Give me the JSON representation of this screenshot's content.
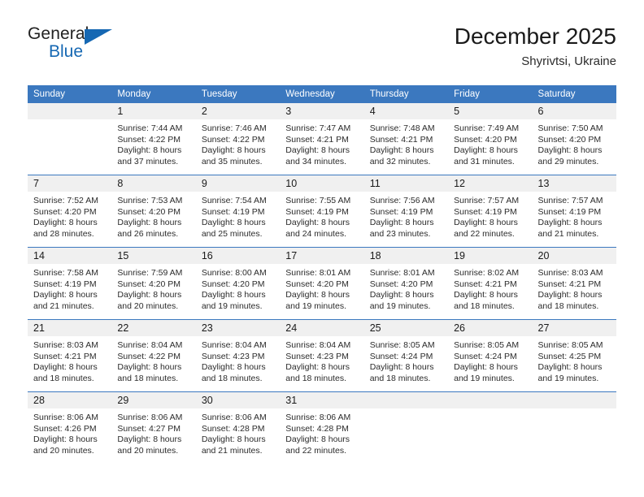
{
  "brand": {
    "word_top": "General",
    "word_bottom": "Blue",
    "accent_color": "#1668b3",
    "triangle_icon": "triangle-right-icon"
  },
  "header": {
    "title": "December 2025",
    "subtitle": "Shyrivtsi, Ukraine"
  },
  "calendar": {
    "header_color": "#3b78bf",
    "daynum_band_color": "#f0f0f0",
    "columns": [
      "Sunday",
      "Monday",
      "Tuesday",
      "Wednesday",
      "Thursday",
      "Friday",
      "Saturday"
    ],
    "labels": {
      "sunrise": "Sunrise:",
      "sunset": "Sunset:",
      "daylight": "Daylight:"
    },
    "weeks": [
      [
        {
          "day": "",
          "sunrise": "",
          "sunset": "",
          "daylight_line1": "",
          "daylight_line2": ""
        },
        {
          "day": "1",
          "sunrise": "Sunrise: 7:44 AM",
          "sunset": "Sunset: 4:22 PM",
          "daylight_line1": "Daylight: 8 hours",
          "daylight_line2": "and 37 minutes."
        },
        {
          "day": "2",
          "sunrise": "Sunrise: 7:46 AM",
          "sunset": "Sunset: 4:22 PM",
          "daylight_line1": "Daylight: 8 hours",
          "daylight_line2": "and 35 minutes."
        },
        {
          "day": "3",
          "sunrise": "Sunrise: 7:47 AM",
          "sunset": "Sunset: 4:21 PM",
          "daylight_line1": "Daylight: 8 hours",
          "daylight_line2": "and 34 minutes."
        },
        {
          "day": "4",
          "sunrise": "Sunrise: 7:48 AM",
          "sunset": "Sunset: 4:21 PM",
          "daylight_line1": "Daylight: 8 hours",
          "daylight_line2": "and 32 minutes."
        },
        {
          "day": "5",
          "sunrise": "Sunrise: 7:49 AM",
          "sunset": "Sunset: 4:20 PM",
          "daylight_line1": "Daylight: 8 hours",
          "daylight_line2": "and 31 minutes."
        },
        {
          "day": "6",
          "sunrise": "Sunrise: 7:50 AM",
          "sunset": "Sunset: 4:20 PM",
          "daylight_line1": "Daylight: 8 hours",
          "daylight_line2": "and 29 minutes."
        }
      ],
      [
        {
          "day": "7",
          "sunrise": "Sunrise: 7:52 AM",
          "sunset": "Sunset: 4:20 PM",
          "daylight_line1": "Daylight: 8 hours",
          "daylight_line2": "and 28 minutes."
        },
        {
          "day": "8",
          "sunrise": "Sunrise: 7:53 AM",
          "sunset": "Sunset: 4:20 PM",
          "daylight_line1": "Daylight: 8 hours",
          "daylight_line2": "and 26 minutes."
        },
        {
          "day": "9",
          "sunrise": "Sunrise: 7:54 AM",
          "sunset": "Sunset: 4:19 PM",
          "daylight_line1": "Daylight: 8 hours",
          "daylight_line2": "and 25 minutes."
        },
        {
          "day": "10",
          "sunrise": "Sunrise: 7:55 AM",
          "sunset": "Sunset: 4:19 PM",
          "daylight_line1": "Daylight: 8 hours",
          "daylight_line2": "and 24 minutes."
        },
        {
          "day": "11",
          "sunrise": "Sunrise: 7:56 AM",
          "sunset": "Sunset: 4:19 PM",
          "daylight_line1": "Daylight: 8 hours",
          "daylight_line2": "and 23 minutes."
        },
        {
          "day": "12",
          "sunrise": "Sunrise: 7:57 AM",
          "sunset": "Sunset: 4:19 PM",
          "daylight_line1": "Daylight: 8 hours",
          "daylight_line2": "and 22 minutes."
        },
        {
          "day": "13",
          "sunrise": "Sunrise: 7:57 AM",
          "sunset": "Sunset: 4:19 PM",
          "daylight_line1": "Daylight: 8 hours",
          "daylight_line2": "and 21 minutes."
        }
      ],
      [
        {
          "day": "14",
          "sunrise": "Sunrise: 7:58 AM",
          "sunset": "Sunset: 4:19 PM",
          "daylight_line1": "Daylight: 8 hours",
          "daylight_line2": "and 21 minutes."
        },
        {
          "day": "15",
          "sunrise": "Sunrise: 7:59 AM",
          "sunset": "Sunset: 4:20 PM",
          "daylight_line1": "Daylight: 8 hours",
          "daylight_line2": "and 20 minutes."
        },
        {
          "day": "16",
          "sunrise": "Sunrise: 8:00 AM",
          "sunset": "Sunset: 4:20 PM",
          "daylight_line1": "Daylight: 8 hours",
          "daylight_line2": "and 19 minutes."
        },
        {
          "day": "17",
          "sunrise": "Sunrise: 8:01 AM",
          "sunset": "Sunset: 4:20 PM",
          "daylight_line1": "Daylight: 8 hours",
          "daylight_line2": "and 19 minutes."
        },
        {
          "day": "18",
          "sunrise": "Sunrise: 8:01 AM",
          "sunset": "Sunset: 4:20 PM",
          "daylight_line1": "Daylight: 8 hours",
          "daylight_line2": "and 19 minutes."
        },
        {
          "day": "19",
          "sunrise": "Sunrise: 8:02 AM",
          "sunset": "Sunset: 4:21 PM",
          "daylight_line1": "Daylight: 8 hours",
          "daylight_line2": "and 18 minutes."
        },
        {
          "day": "20",
          "sunrise": "Sunrise: 8:03 AM",
          "sunset": "Sunset: 4:21 PM",
          "daylight_line1": "Daylight: 8 hours",
          "daylight_line2": "and 18 minutes."
        }
      ],
      [
        {
          "day": "21",
          "sunrise": "Sunrise: 8:03 AM",
          "sunset": "Sunset: 4:21 PM",
          "daylight_line1": "Daylight: 8 hours",
          "daylight_line2": "and 18 minutes."
        },
        {
          "day": "22",
          "sunrise": "Sunrise: 8:04 AM",
          "sunset": "Sunset: 4:22 PM",
          "daylight_line1": "Daylight: 8 hours",
          "daylight_line2": "and 18 minutes."
        },
        {
          "day": "23",
          "sunrise": "Sunrise: 8:04 AM",
          "sunset": "Sunset: 4:23 PM",
          "daylight_line1": "Daylight: 8 hours",
          "daylight_line2": "and 18 minutes."
        },
        {
          "day": "24",
          "sunrise": "Sunrise: 8:04 AM",
          "sunset": "Sunset: 4:23 PM",
          "daylight_line1": "Daylight: 8 hours",
          "daylight_line2": "and 18 minutes."
        },
        {
          "day": "25",
          "sunrise": "Sunrise: 8:05 AM",
          "sunset": "Sunset: 4:24 PM",
          "daylight_line1": "Daylight: 8 hours",
          "daylight_line2": "and 18 minutes."
        },
        {
          "day": "26",
          "sunrise": "Sunrise: 8:05 AM",
          "sunset": "Sunset: 4:24 PM",
          "daylight_line1": "Daylight: 8 hours",
          "daylight_line2": "and 19 minutes."
        },
        {
          "day": "27",
          "sunrise": "Sunrise: 8:05 AM",
          "sunset": "Sunset: 4:25 PM",
          "daylight_line1": "Daylight: 8 hours",
          "daylight_line2": "and 19 minutes."
        }
      ],
      [
        {
          "day": "28",
          "sunrise": "Sunrise: 8:06 AM",
          "sunset": "Sunset: 4:26 PM",
          "daylight_line1": "Daylight: 8 hours",
          "daylight_line2": "and 20 minutes."
        },
        {
          "day": "29",
          "sunrise": "Sunrise: 8:06 AM",
          "sunset": "Sunset: 4:27 PM",
          "daylight_line1": "Daylight: 8 hours",
          "daylight_line2": "and 20 minutes."
        },
        {
          "day": "30",
          "sunrise": "Sunrise: 8:06 AM",
          "sunset": "Sunset: 4:28 PM",
          "daylight_line1": "Daylight: 8 hours",
          "daylight_line2": "and 21 minutes."
        },
        {
          "day": "31",
          "sunrise": "Sunrise: 8:06 AM",
          "sunset": "Sunset: 4:28 PM",
          "daylight_line1": "Daylight: 8 hours",
          "daylight_line2": "and 22 minutes."
        },
        {
          "day": "",
          "sunrise": "",
          "sunset": "",
          "daylight_line1": "",
          "daylight_line2": ""
        },
        {
          "day": "",
          "sunrise": "",
          "sunset": "",
          "daylight_line1": "",
          "daylight_line2": ""
        },
        {
          "day": "",
          "sunrise": "",
          "sunset": "",
          "daylight_line1": "",
          "daylight_line2": ""
        }
      ]
    ]
  }
}
